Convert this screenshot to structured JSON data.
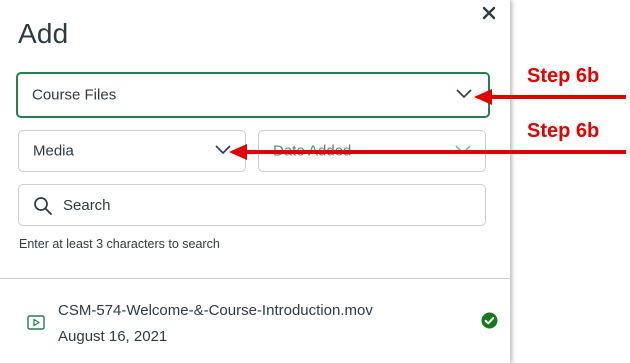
{
  "dialog": {
    "title": "Add",
    "close_icon": "close-icon"
  },
  "filters": {
    "source": {
      "value": "Course Files",
      "icon": "chevron-down-icon"
    },
    "content_type": {
      "value": "Media",
      "icon": "chevron-down-icon"
    },
    "sort": {
      "value": "Date Added",
      "icon": "chevron-down-icon"
    }
  },
  "search": {
    "placeholder": "Search",
    "value": "",
    "icon": "search-icon",
    "hint": "Enter at least 3 characters to search"
  },
  "files": [
    {
      "name": "CSM-574-Welcome-&-Course-Introduction.mov",
      "date": "August 16, 2021",
      "icon": "video-file-icon",
      "status_icon": "check-circle-icon"
    }
  ],
  "annotations": [
    {
      "label": "Step 6b",
      "color": "#e00000"
    },
    {
      "label": "Step 6b",
      "color": "#e00000"
    }
  ],
  "colors": {
    "accent_border": "#2a7d4f",
    "success": "#127a1b",
    "annotation": "#e00000",
    "text": "#2d3b45"
  }
}
